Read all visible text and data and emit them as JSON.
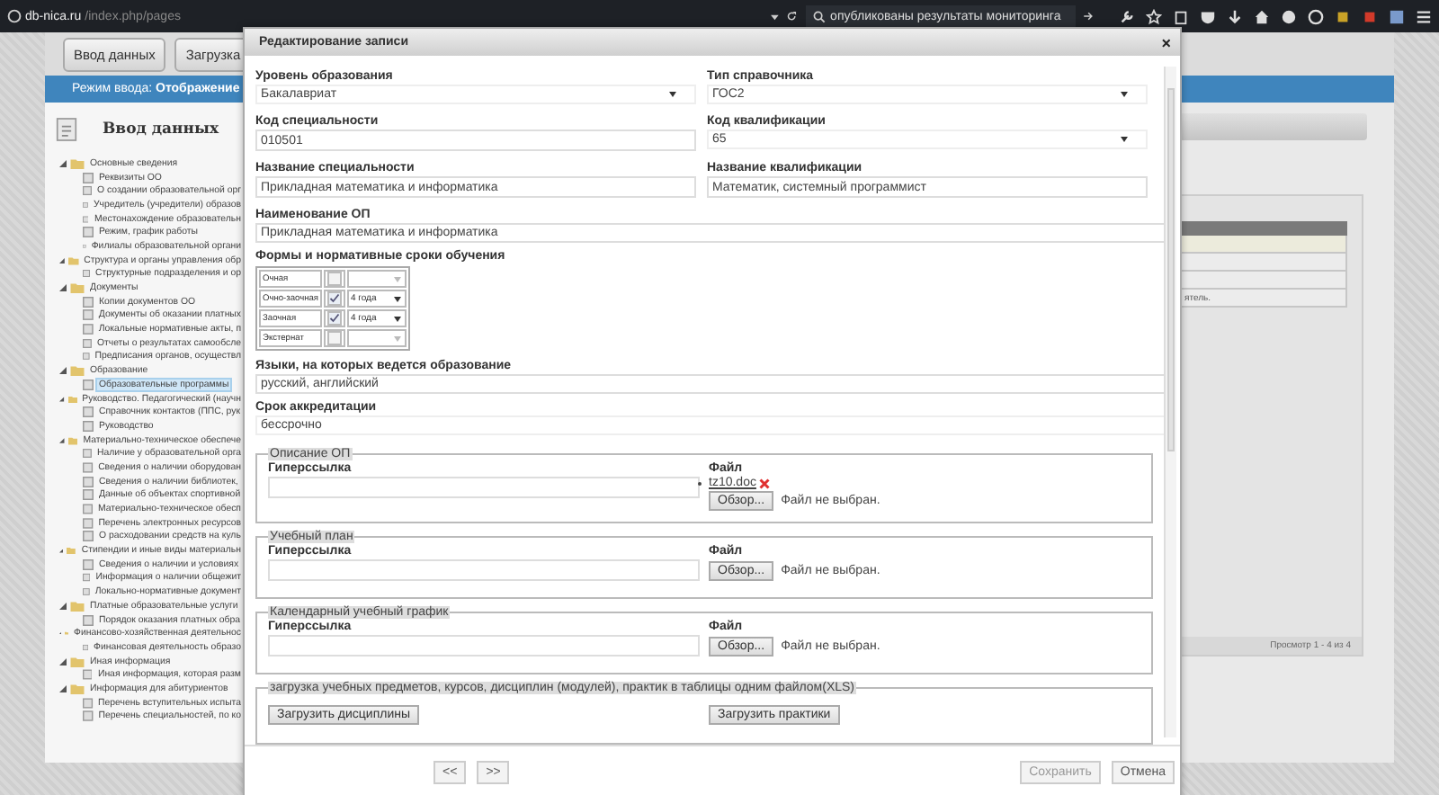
{
  "browser": {
    "url_host": "db-nica.ru",
    "url_path": "/index.php/pages",
    "search_query": "опубликованы результаты мониторинга"
  },
  "page": {
    "buttons": [
      "Ввод данных",
      "Загрузка"
    ],
    "mode_bar": "Режим ввода: **Отображение**",
    "panel_title": "Ввод данных",
    "tree": [
      {
        "label": "Основные сведения",
        "expanded": true,
        "children": [
          {
            "label": "Реквизиты ОО",
            "selected": false
          },
          {
            "label": "О создании образовательной орг",
            "selected": false
          },
          {
            "label": "Учредитель (учредители) образов",
            "selected": false
          },
          {
            "label": "Местонахождение образовательн",
            "selected": false
          },
          {
            "label": "Режим, график работы",
            "selected": false
          },
          {
            "label": "Филиалы образовательной органи",
            "selected": false
          }
        ]
      },
      {
        "label": "Структура и органы управления обр",
        "expanded": true,
        "children": [
          {
            "label": "Структурные подразделения и ор",
            "selected": false
          }
        ]
      },
      {
        "label": "Документы",
        "expanded": true,
        "children": [
          {
            "label": "Копии документов ОО",
            "selected": false
          },
          {
            "label": "Документы об оказании платных",
            "selected": false
          },
          {
            "label": "Локальные нормативные акты, п",
            "selected": false
          },
          {
            "label": "Отчеты о результатах самообсле",
            "selected": false
          },
          {
            "label": "Предписания органов, осуществл",
            "selected": false
          }
        ]
      },
      {
        "label": "Образование",
        "expanded": true,
        "children": [
          {
            "label": "Образовательные программы",
            "selected": true
          }
        ]
      },
      {
        "label": "Руководство. Педагогический (научн",
        "expanded": true,
        "children": [
          {
            "label": "Справочник контактов (ППС, рук",
            "selected": false
          },
          {
            "label": "Руководство",
            "selected": false
          }
        ]
      },
      {
        "label": "Материально-техническое обеспече",
        "expanded": true,
        "children": [
          {
            "label": "Наличие у образовательной орга",
            "selected": false
          },
          {
            "label": "Сведения о наличии оборудован",
            "selected": false
          },
          {
            "label": "Сведения о наличии библиотек,",
            "selected": false
          },
          {
            "label": "Данные об объектах спортивной",
            "selected": false
          },
          {
            "label": "Материально-техническое обесп",
            "selected": false
          },
          {
            "label": "Перечень электронных ресурсов",
            "selected": false
          },
          {
            "label": "О расходовании средств на куль",
            "selected": false
          }
        ]
      },
      {
        "label": "Стипендии и иные виды материальн",
        "expanded": true,
        "children": [
          {
            "label": "Сведения о наличии и условиях",
            "selected": false
          },
          {
            "label": "Информация о наличии общежит",
            "selected": false
          },
          {
            "label": "Локально-нормативные документ",
            "selected": false
          }
        ]
      },
      {
        "label": "Платные образовательные услуги",
        "expanded": true,
        "children": [
          {
            "label": "Порядок оказания платных обра",
            "selected": false
          }
        ]
      },
      {
        "label": "Финансово-хозяйственная деятельнос",
        "expanded": true,
        "children": [
          {
            "label": "Финансовая деятельность образо",
            "selected": false
          }
        ]
      },
      {
        "label": "Иная информация",
        "expanded": true,
        "children": [
          {
            "label": "Иная информация, которая разм",
            "selected": false
          }
        ]
      },
      {
        "label": "Информация для абитуриентов",
        "expanded": true,
        "children": [
          {
            "label": "Перечень вступительных испыта",
            "selected": false
          },
          {
            "label": "Перечень специальностей, по ко",
            "selected": false
          }
        ]
      }
    ],
    "grid": {
      "rows": [
        {
          "selected": true
        },
        {
          "selected": false
        },
        {
          "selected": false
        },
        {
          "selected": false,
          "text": "ятель."
        }
      ],
      "pager": "Просмотр 1 - 4 из 4"
    }
  },
  "dialog": {
    "title": "Редактирование записи",
    "close": "×",
    "fields": [
      {
        "kind": "select",
        "label": "Уровень образования",
        "value": "Бакалавриат"
      },
      {
        "kind": "select",
        "label": "Тип справочника",
        "value": "ГОС2"
      },
      {
        "kind": "input",
        "label": "Код специальности",
        "value": "010501"
      },
      {
        "kind": "select",
        "label": "Код квалификации",
        "value": "65"
      },
      {
        "kind": "input",
        "label": "Название специальности",
        "value": "Прикладная математика и информатика"
      },
      {
        "kind": "input",
        "label": "Название квалификации",
        "value": "Математик, системный программист"
      }
    ],
    "program_name": {
      "label": "Наименование ОП",
      "value": "Прикладная математика и информатика"
    },
    "forms": {
      "label": "Формы и нормативные сроки обучения",
      "rows": [
        {
          "name": "Очная",
          "checked": false
        },
        {
          "name": "Очно-заочная",
          "checked": true,
          "duration": "4 года"
        },
        {
          "name": "Заочная",
          "checked": true,
          "duration": "4 года"
        },
        {
          "name": "Экстернат",
          "checked": false
        }
      ]
    },
    "languages": {
      "label": "Языки, на которых ведется образование",
      "value": "русский, английский"
    },
    "accreditation": {
      "label": "Срок аккредитации",
      "value": "бессрочно"
    },
    "sections": [
      {
        "legend": "Описание ОП",
        "link_label": "Гиперссылка",
        "file_label": "Файл",
        "files": [
          "tz10.doc"
        ],
        "browse": "Обзор...",
        "no_file": "Файл не выбран."
      },
      {
        "legend": "Учебный план",
        "link_label": "Гиперссылка",
        "file_label": "Файл",
        "browse": "Обзор...",
        "no_file": "Файл не выбран."
      },
      {
        "legend": "Календарный учебный график",
        "link_label": "Гиперссылка",
        "file_label": "Файл",
        "browse": "Обзор...",
        "no_file": "Файл не выбран."
      }
    ],
    "upload": {
      "legend": "загрузка учебных предметов, курсов, дисциплин (модулей), практик в таблицы одним файлом(XLS)",
      "buttons": [
        "Загрузить дисциплины",
        "Загрузить практики"
      ]
    },
    "nav": [
      "<<",
      ">>"
    ],
    "footer_buttons": [
      {
        "label": "Сохранить",
        "disabled": true
      },
      {
        "label": "Отмена",
        "disabled": false
      }
    ]
  }
}
